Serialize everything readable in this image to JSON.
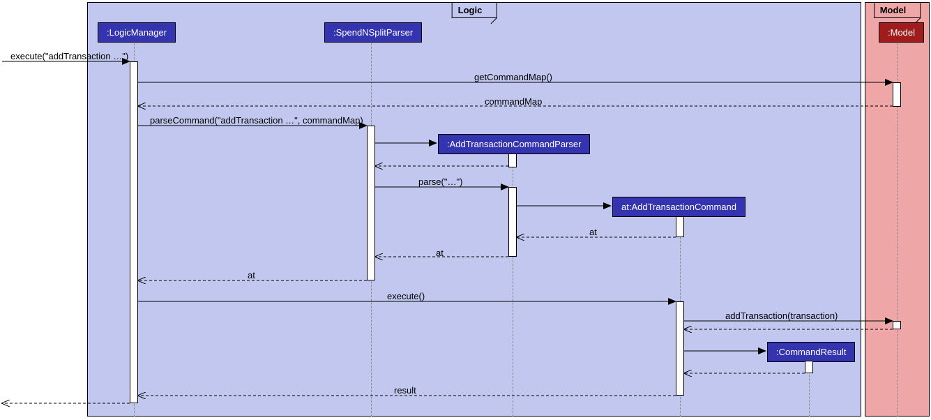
{
  "frames": {
    "logic": {
      "label": "Logic",
      "color": "#C1C7EE"
    },
    "model": {
      "label": "Model",
      "color": "#EFA6A6"
    }
  },
  "participants": {
    "logicManager": {
      "label": ":LogicManager",
      "color": "#3434B0"
    },
    "parser": {
      "label": ":SpendNSplitParser",
      "color": "#3434B0"
    },
    "atcParser": {
      "label": ":AddTransactionCommandParser",
      "color": "#3434B0"
    },
    "atc": {
      "label": "at:AddTransactionCommand",
      "color": "#3434B0"
    },
    "cmdResult": {
      "label": ":CommandResult",
      "color": "#3434B0"
    },
    "model": {
      "label": ":Model",
      "color": "#A01B1B"
    }
  },
  "messages": {
    "execute": "execute(\"addTransaction …\")",
    "getCommandMap": "getCommandMap()",
    "commandMap": "commandMap",
    "parseCommand": "parseCommand(\"addTransaction …\", commandMap)",
    "parse": "parse(\"…\")",
    "at1": "at",
    "at2": "at",
    "at3": "at",
    "executeCmd": "execute()",
    "addTransaction": "addTransaction(transaction)",
    "result": "result"
  }
}
